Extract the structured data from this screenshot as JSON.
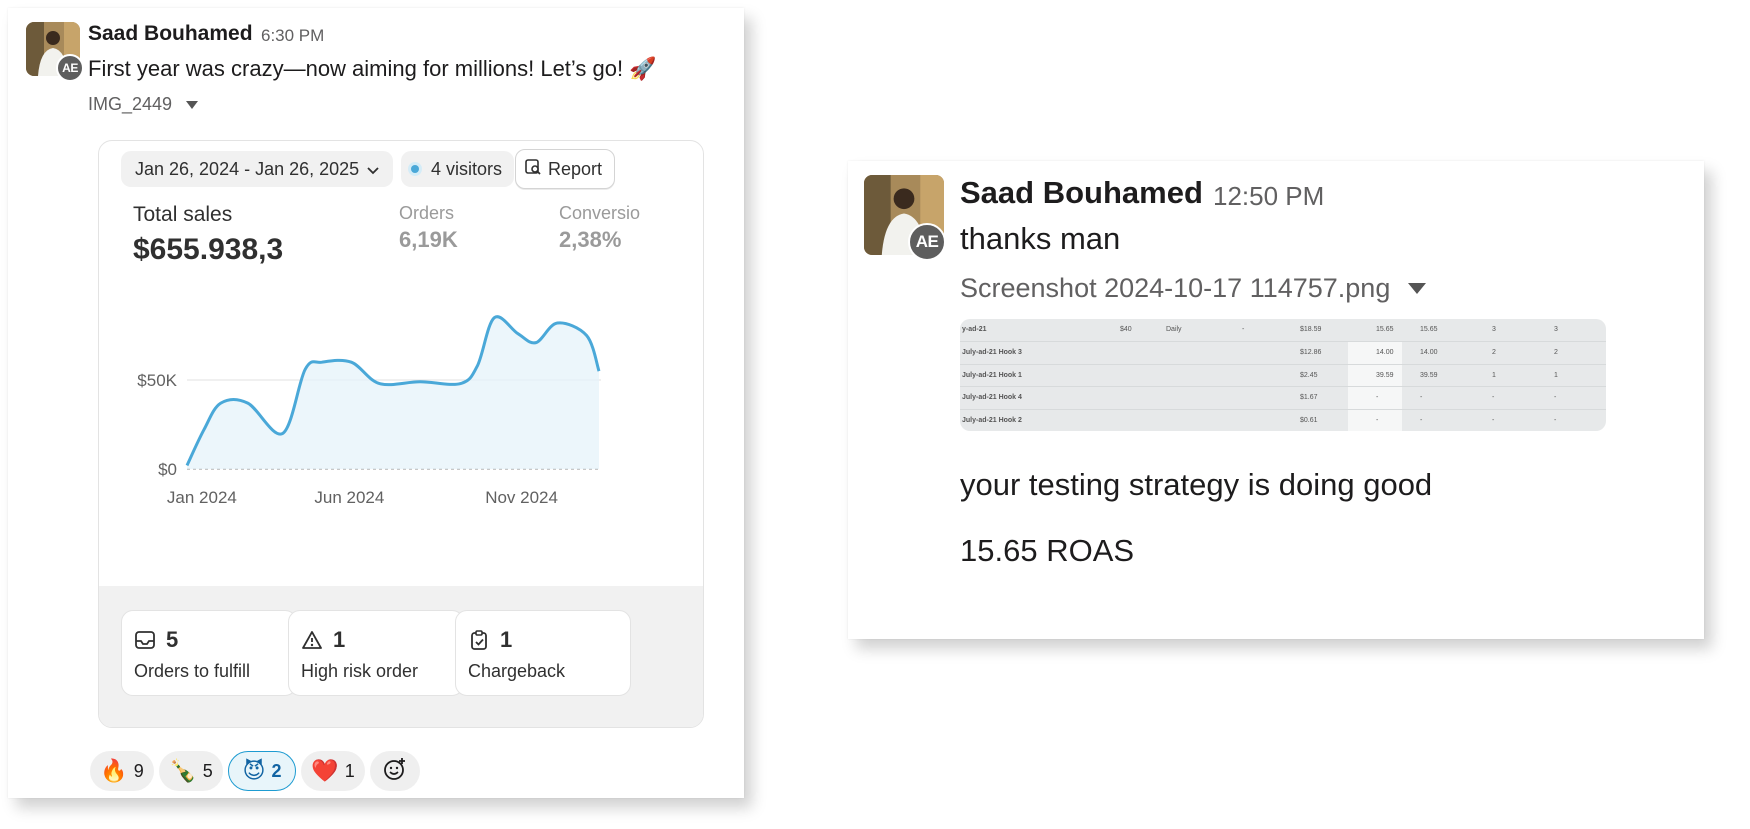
{
  "left_message": {
    "author": "Saad Bouhamed",
    "time": "6:30 PM",
    "avatar_badge": "AE",
    "text": "First year was crazy—now aiming for millions! Let’s go! 🚀",
    "attachment_name": "IMG_2449",
    "shopify": {
      "date_range": "Jan 26, 2024 - Jan 26, 2025",
      "visitors": "4 visitors",
      "report_label": "Report",
      "total_sales_label": "Total sales",
      "total_sales_value": "$655.938,3",
      "orders_label": "Orders",
      "orders_value": "6,19K",
      "conversion_label": "Conversio",
      "conversion_value": "2,38%",
      "tiles": [
        {
          "value": "5",
          "label": "Orders to fulfill",
          "icon": "inbox-icon"
        },
        {
          "value": "1",
          "label": "High risk order",
          "icon": "warning-icon"
        },
        {
          "value": "1",
          "label": "Chargeback",
          "icon": "clipboard-check-icon"
        }
      ]
    },
    "reactions": [
      {
        "emoji": "🔥",
        "count": "9",
        "active": false
      },
      {
        "emoji": "🍾",
        "count": "5",
        "active": false
      },
      {
        "emoji": "😈",
        "count": "2",
        "active": true
      },
      {
        "emoji": "❤️",
        "count": "1",
        "active": false
      }
    ],
    "add_reaction_icon": "add-reaction-icon"
  },
  "chart_data": {
    "type": "area",
    "title": "Total sales",
    "x_tick_labels": [
      "Jan 2024",
      "Jun 2024",
      "Nov 2024"
    ],
    "y_tick_labels": [
      "$0",
      "$50K"
    ],
    "ylim": [
      0,
      100000
    ],
    "grid": "horizontal",
    "color": "#4aa8d8",
    "series": [
      {
        "x": [
          "2024-01-26",
          "2024-02-10",
          "2024-02-25",
          "2024-03-20",
          "2024-04-20",
          "2024-05-10",
          "2024-05-25",
          "2024-06-20",
          "2024-07-15",
          "2024-08-20",
          "2024-09-25",
          "2024-10-10",
          "2024-10-25",
          "2024-11-15",
          "2024-12-01",
          "2024-12-20",
          "2025-01-15",
          "2025-01-26"
        ],
        "values": [
          2000,
          22000,
          37000,
          37000,
          20000,
          56000,
          60000,
          60000,
          48000,
          49000,
          48000,
          58000,
          85000,
          76000,
          71000,
          82000,
          75000,
          55000
        ]
      }
    ]
  },
  "right_message": {
    "author": "Saad Bouhamed",
    "time": "12:50 PM",
    "avatar_badge": "AE",
    "text1": "thanks man",
    "attachment_name": "Screenshot 2024-10-17 114757.png",
    "text2": "your testing strategy is doing good",
    "text3": "15.65 ROAS",
    "table_rows": [
      {
        "name": "y-ad-21",
        "budget": "$40",
        "freq": "Daily",
        "dash": "-",
        "spend": "$18.59",
        "roas": "15.65",
        "roas2": "15.65",
        "a": "3",
        "b": "3"
      },
      {
        "name": "July-ad-21 Hook 3",
        "budget": "",
        "freq": "",
        "dash": "",
        "spend": "$12.86",
        "roas": "14.00",
        "roas2": "14.00",
        "a": "2",
        "b": "2"
      },
      {
        "name": "July-ad-21 Hook 1",
        "budget": "",
        "freq": "",
        "dash": "",
        "spend": "$2.45",
        "roas": "39.59",
        "roas2": "39.59",
        "a": "1",
        "b": "1"
      },
      {
        "name": "July-ad-21 Hook 4",
        "budget": "",
        "freq": "",
        "dash": "",
        "spend": "$1.67",
        "roas": "-",
        "roas2": "-",
        "a": "-",
        "b": "-"
      },
      {
        "name": "July-ad-21 Hook 2",
        "budget": "",
        "freq": "",
        "dash": "",
        "spend": "$0.61",
        "roas": "-",
        "roas2": "-",
        "a": "-",
        "b": "-"
      }
    ]
  }
}
